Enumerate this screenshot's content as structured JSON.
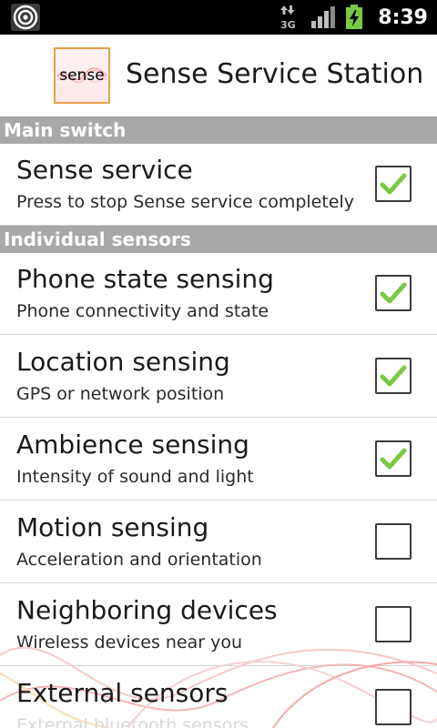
{
  "status_bar": {
    "network_type": "3G",
    "time": "8:39"
  },
  "app": {
    "title": "Sense Service Station",
    "logo_text": "sense"
  },
  "sections": {
    "main_switch": "Main switch",
    "individual_sensors": "Individual sensors"
  },
  "prefs": [
    {
      "title": "Sense service",
      "summary": "Press to stop Sense service completely",
      "checked": true
    },
    {
      "title": "Phone state sensing",
      "summary": "Phone connectivity and state",
      "checked": true
    },
    {
      "title": "Location sensing",
      "summary": "GPS or network position",
      "checked": true
    },
    {
      "title": "Ambience sensing",
      "summary": "Intensity of sound and light",
      "checked": true
    },
    {
      "title": "Motion sensing",
      "summary": "Acceleration and orientation",
      "checked": false
    },
    {
      "title": "Neighboring devices",
      "summary": "Wireless devices near you",
      "checked": false
    },
    {
      "title": "External sensors",
      "summary": "External bluetooth sensors",
      "checked": false
    }
  ],
  "colors": {
    "status_bar_bg": "#000000",
    "section_header_bg": "#a8a8a8",
    "check_green": "#7ac943",
    "logo_border": "#e8a04a"
  },
  "icons": {
    "notification": "target-icon",
    "data": "data-arrows-icon",
    "signal": "signal-icon",
    "battery": "battery-charging-icon",
    "check": "check-icon"
  }
}
